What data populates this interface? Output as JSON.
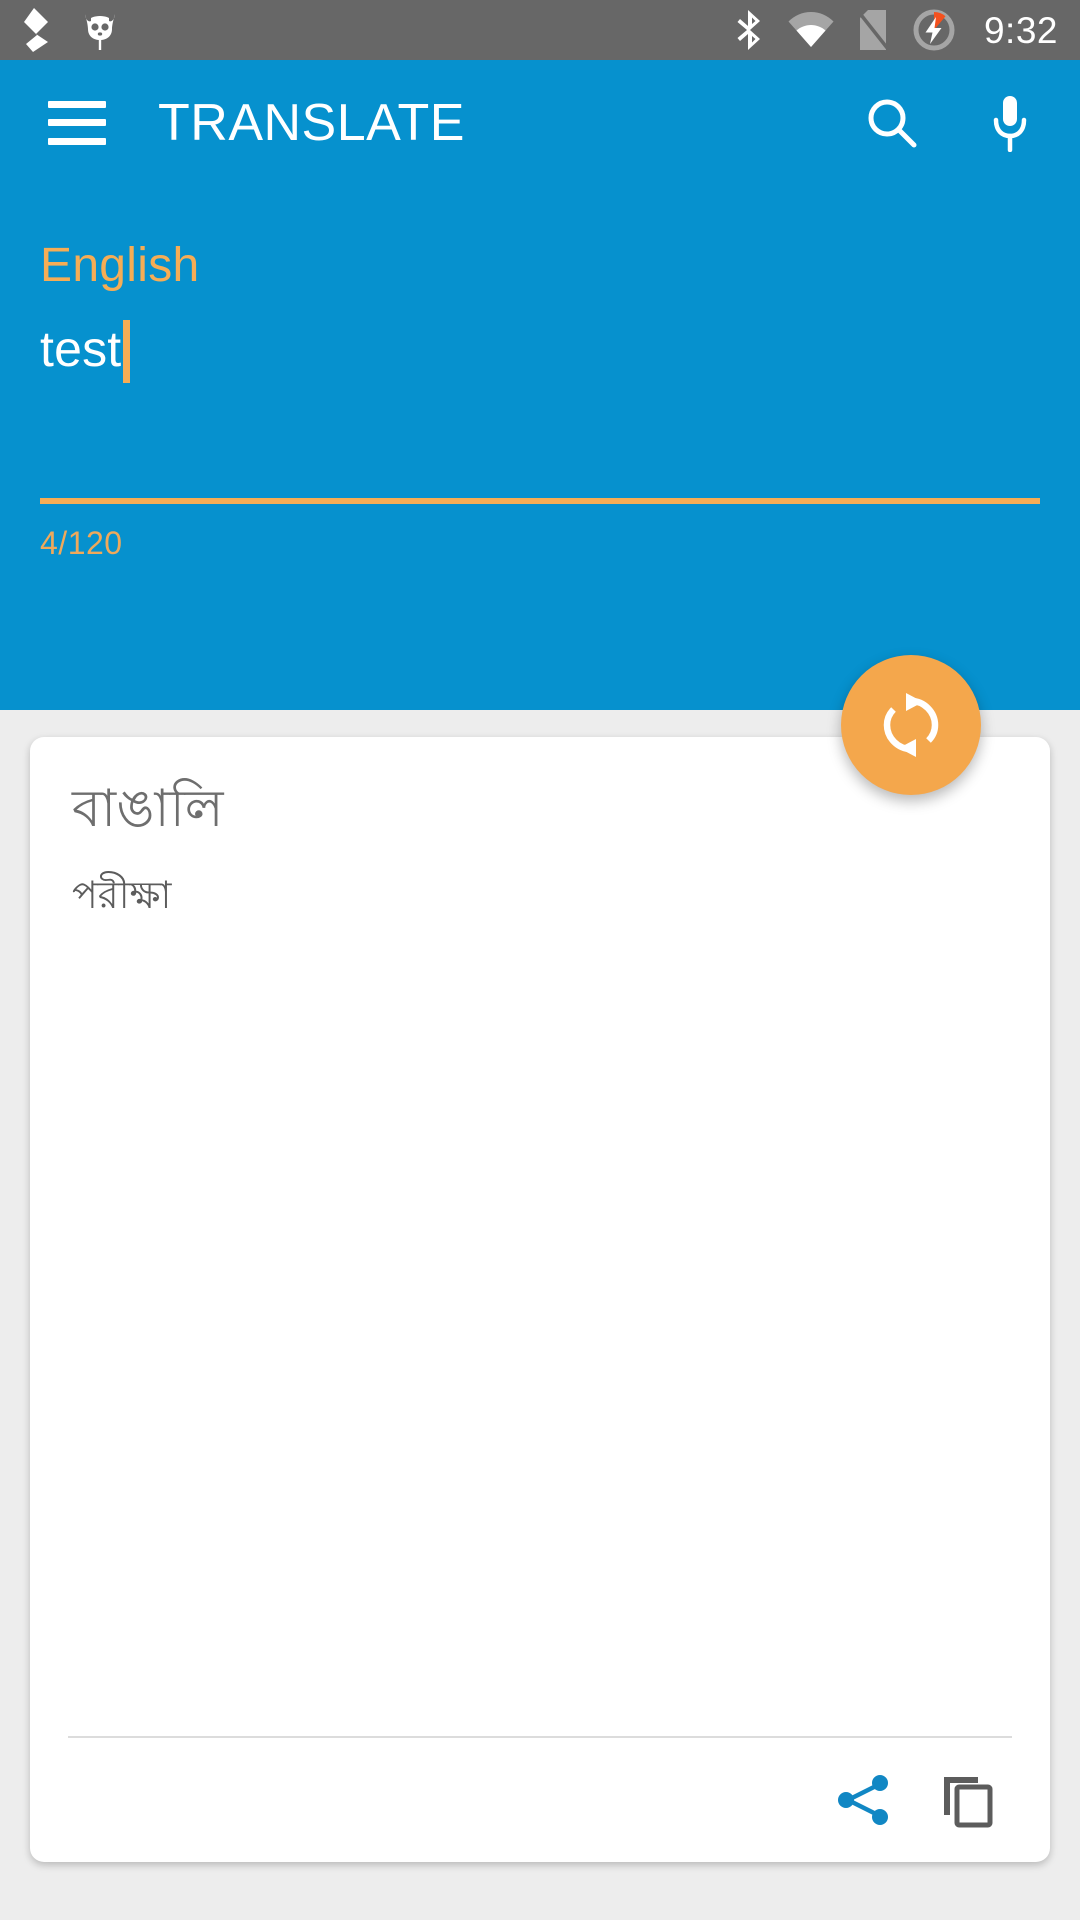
{
  "status_bar": {
    "clock": "9:32",
    "background_color": "#676767",
    "left_icons": [
      "cyanogen-k-icon",
      "cyanogenmod-cid-icon"
    ],
    "right_icons": [
      "bluetooth-icon",
      "wifi-icon",
      "no-sim-icon",
      "battery-charging-icon"
    ]
  },
  "app_bar": {
    "title": "TRANSLATE",
    "background_color": "#0691ce",
    "menu_icon": "hamburger-menu-icon",
    "search_icon": "search-icon",
    "mic_icon": "microphone-icon"
  },
  "source": {
    "language": "English",
    "text": "test",
    "char_counter": "4/120",
    "accent_color": "#f6ad55",
    "panel_color": "#0691ce"
  },
  "swap": {
    "icon": "swap-refresh-icon",
    "color": "#f4a74c"
  },
  "result": {
    "language": "বাঙালি",
    "translation": "পরীক্ষা",
    "share_icon": "share-icon",
    "copy_icon": "copy-icon",
    "share_color": "#1187c4",
    "copy_color": "#5c5c5c"
  }
}
